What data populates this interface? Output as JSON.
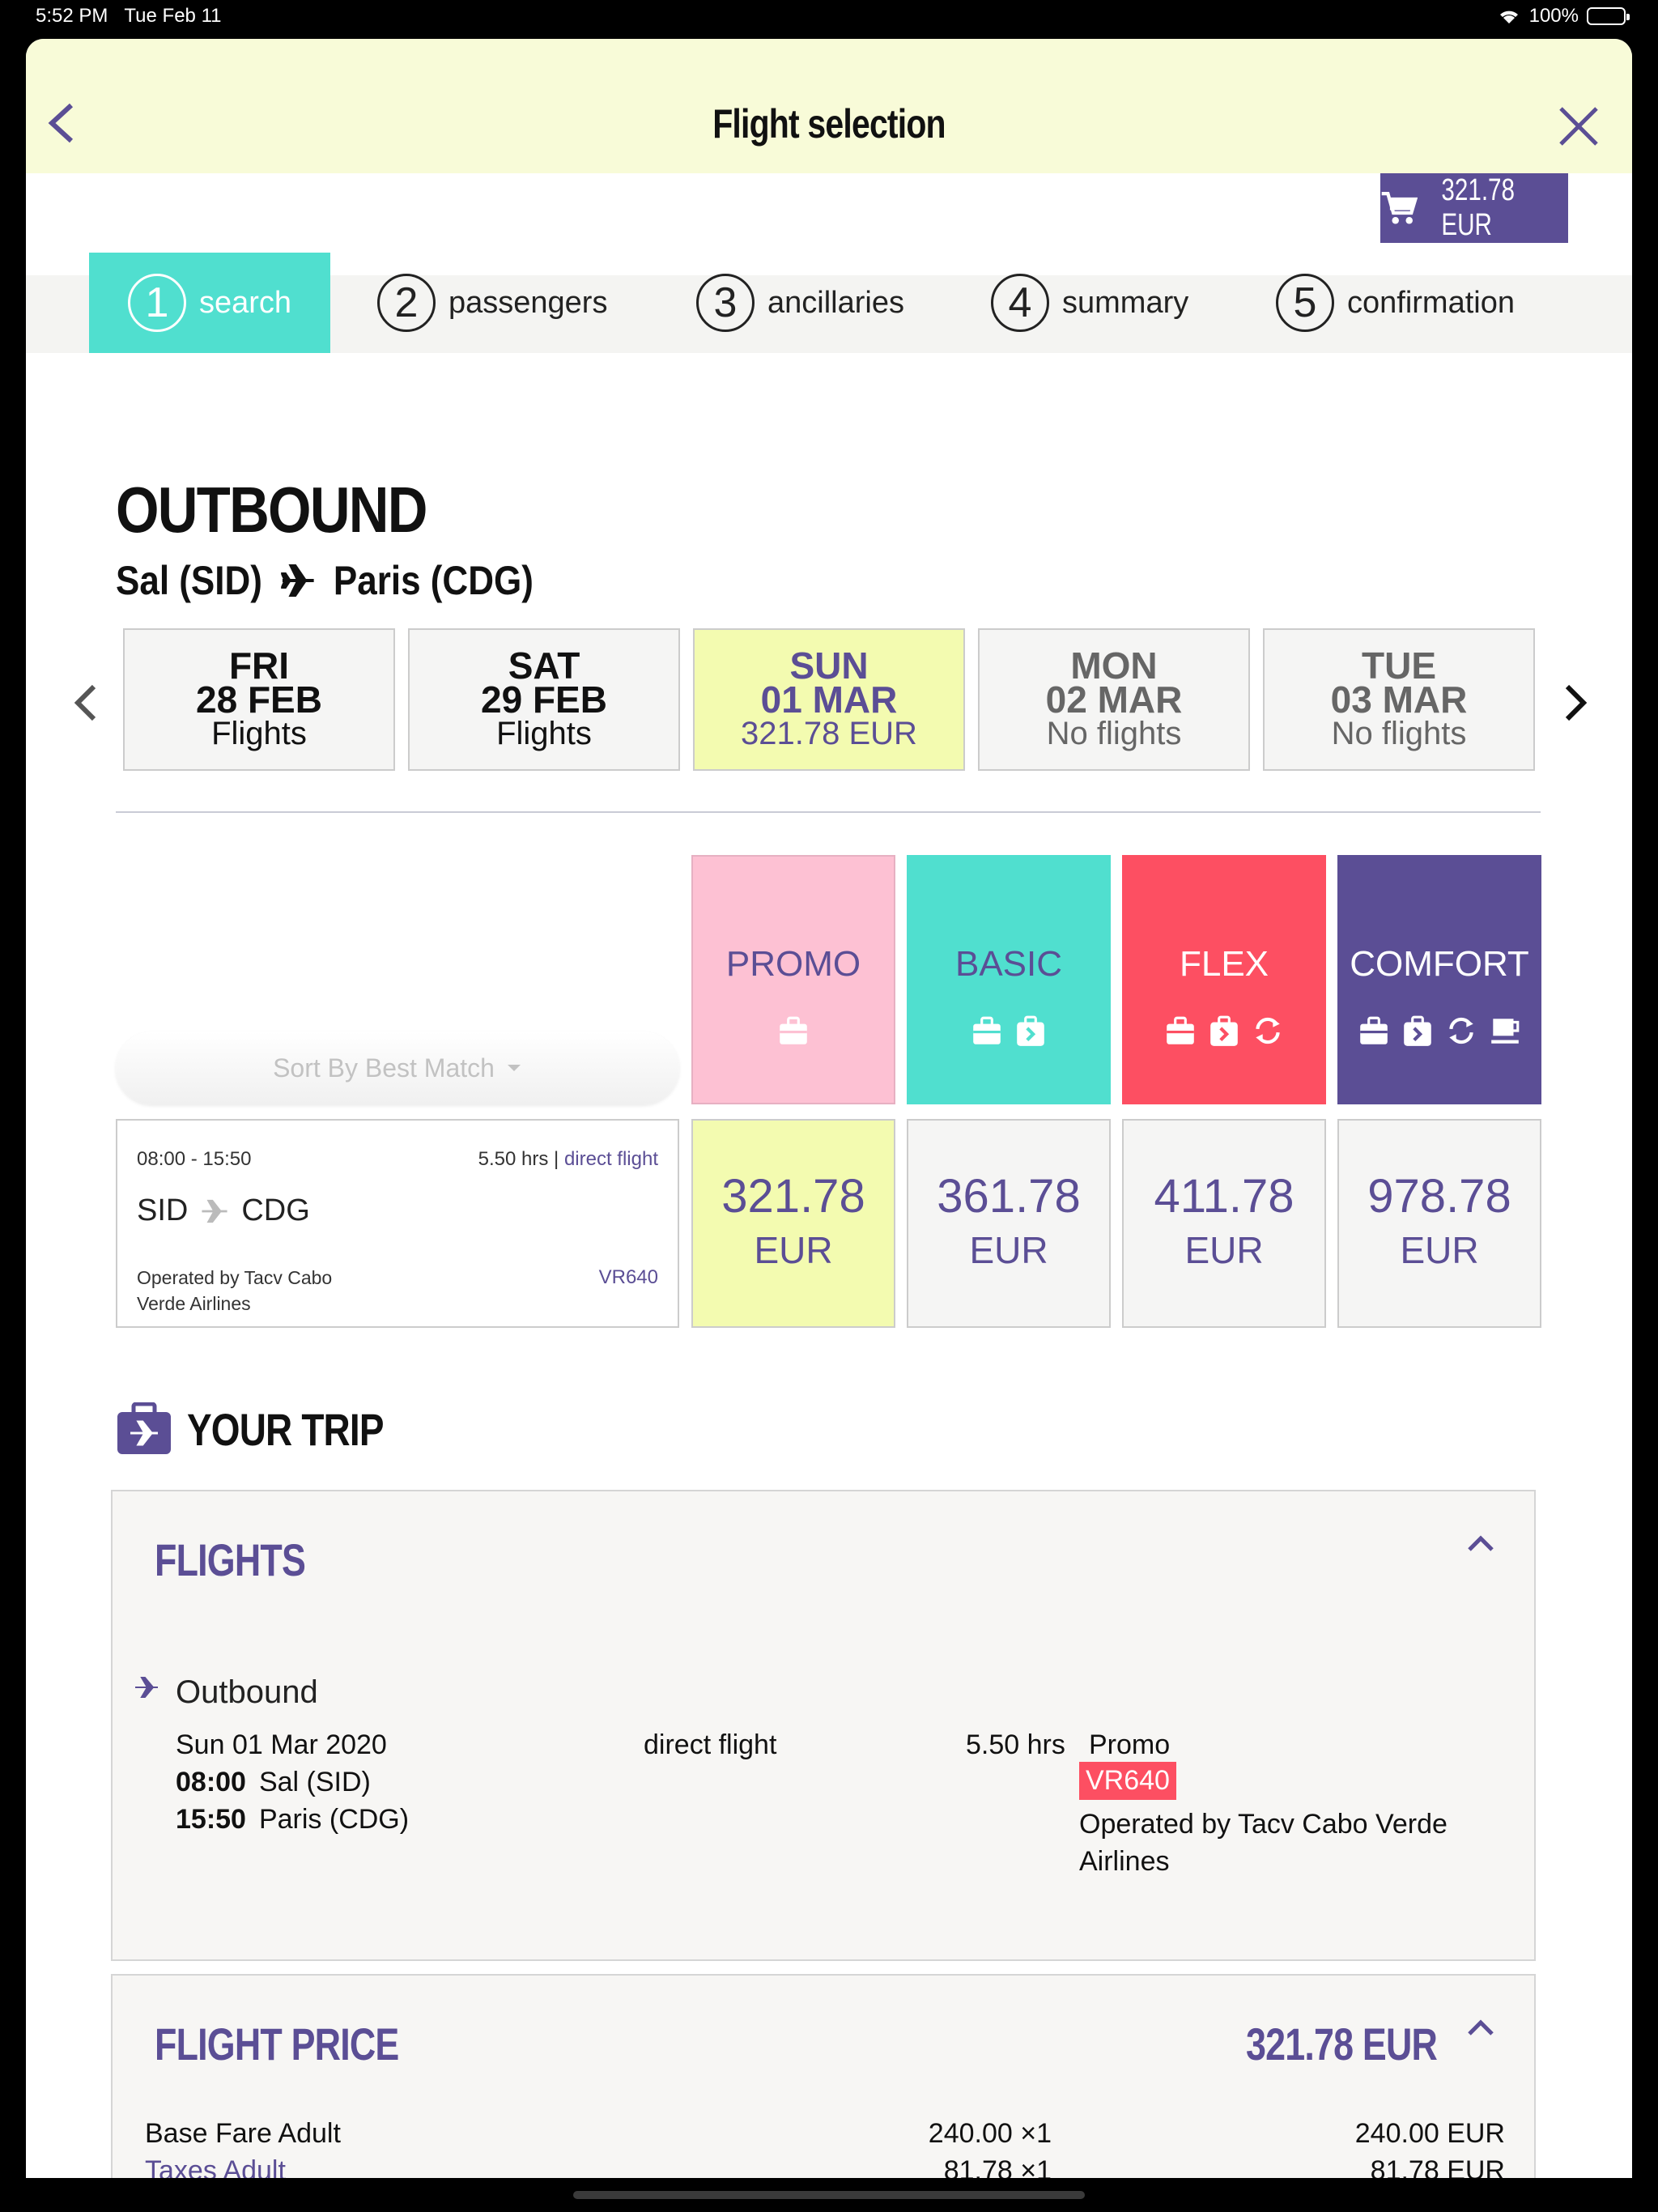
{
  "status": {
    "time": "5:52 PM",
    "date": "Tue Feb 11",
    "battery": "100%"
  },
  "header": {
    "title": "Flight selection"
  },
  "cart": {
    "amount": "321.78 EUR"
  },
  "steps": [
    {
      "num": "1",
      "label": "search",
      "active": true
    },
    {
      "num": "2",
      "label": "passengers"
    },
    {
      "num": "3",
      "label": "ancillaries"
    },
    {
      "num": "4",
      "label": "summary"
    },
    {
      "num": "5",
      "label": "confirmation"
    }
  ],
  "outbound": {
    "title": "OUTBOUND",
    "origin": "Sal (SID)",
    "destination": "Paris (CDG)",
    "dates": [
      {
        "dow": "FRI",
        "day": "28 FEB",
        "sub": "Flights"
      },
      {
        "dow": "SAT",
        "day": "29 FEB",
        "sub": "Flights"
      },
      {
        "dow": "SUN",
        "day": "01 MAR",
        "sub": "321.78 EUR",
        "selected": true
      },
      {
        "dow": "MON",
        "day": "02 MAR",
        "sub": "No flights"
      },
      {
        "dow": "TUE",
        "day": "03 MAR",
        "sub": "No flights"
      }
    ]
  },
  "fares": {
    "sort_label": "Sort By Best Match",
    "columns": [
      {
        "name": "PROMO",
        "icons": [
          "suitcase-icon"
        ],
        "color": "#fdc1d3"
      },
      {
        "name": "BASIC",
        "icons": [
          "suitcase-icon",
          "bag-forward-icon"
        ],
        "color": "#50dfcf"
      },
      {
        "name": "FLEX",
        "icons": [
          "suitcase-icon",
          "bag-forward-icon",
          "refresh-icon"
        ],
        "color": "#fd4f62"
      },
      {
        "name": "COMFORT",
        "icons": [
          "suitcase-icon",
          "bag-forward-icon",
          "refresh-icon",
          "coffee-icon"
        ],
        "color": "#5b4e95"
      }
    ],
    "flight": {
      "time": "08:00 - 15:50",
      "duration": "5.50 hrs |",
      "direct": "direct flight",
      "from": "SID",
      "to": "CDG",
      "operator": "Operated by Tacv Cabo Verde Airlines",
      "number": "VR640"
    },
    "prices": [
      {
        "value": "321.78",
        "currency": "EUR",
        "selected": true
      },
      {
        "value": "361.78",
        "currency": "EUR"
      },
      {
        "value": "411.78",
        "currency": "EUR"
      },
      {
        "value": "978.78",
        "currency": "EUR"
      }
    ]
  },
  "trip": {
    "title": "YOUR TRIP",
    "flights": {
      "heading": "FLIGHTS",
      "label": "Outbound",
      "date": "Sun 01 Mar 2020",
      "direct": "direct flight",
      "hours": "5.50 hrs",
      "fare": "Promo",
      "dep_time": "08:00",
      "dep_place": "Sal (SID)",
      "arr_time": "15:50",
      "arr_place": "Paris (CDG)",
      "flight_number": "VR640",
      "operator": "Operated by Tacv Cabo Verde Airlines"
    },
    "price": {
      "heading": "FLIGHT PRICE",
      "total": "321.78 EUR",
      "rows": [
        {
          "label": "Base Fare Adult",
          "qty": "240.00 ×1",
          "amount": "240.00 EUR"
        },
        {
          "label": "Taxes Adult",
          "qty": "81.78 ×1",
          "amount": "81.78 EUR"
        }
      ]
    }
  },
  "colors": {
    "accent": "#5b4e95",
    "teal": "#50dfcf",
    "header_bg": "#f8fbd8",
    "selected_bg": "#f3fbb0"
  }
}
